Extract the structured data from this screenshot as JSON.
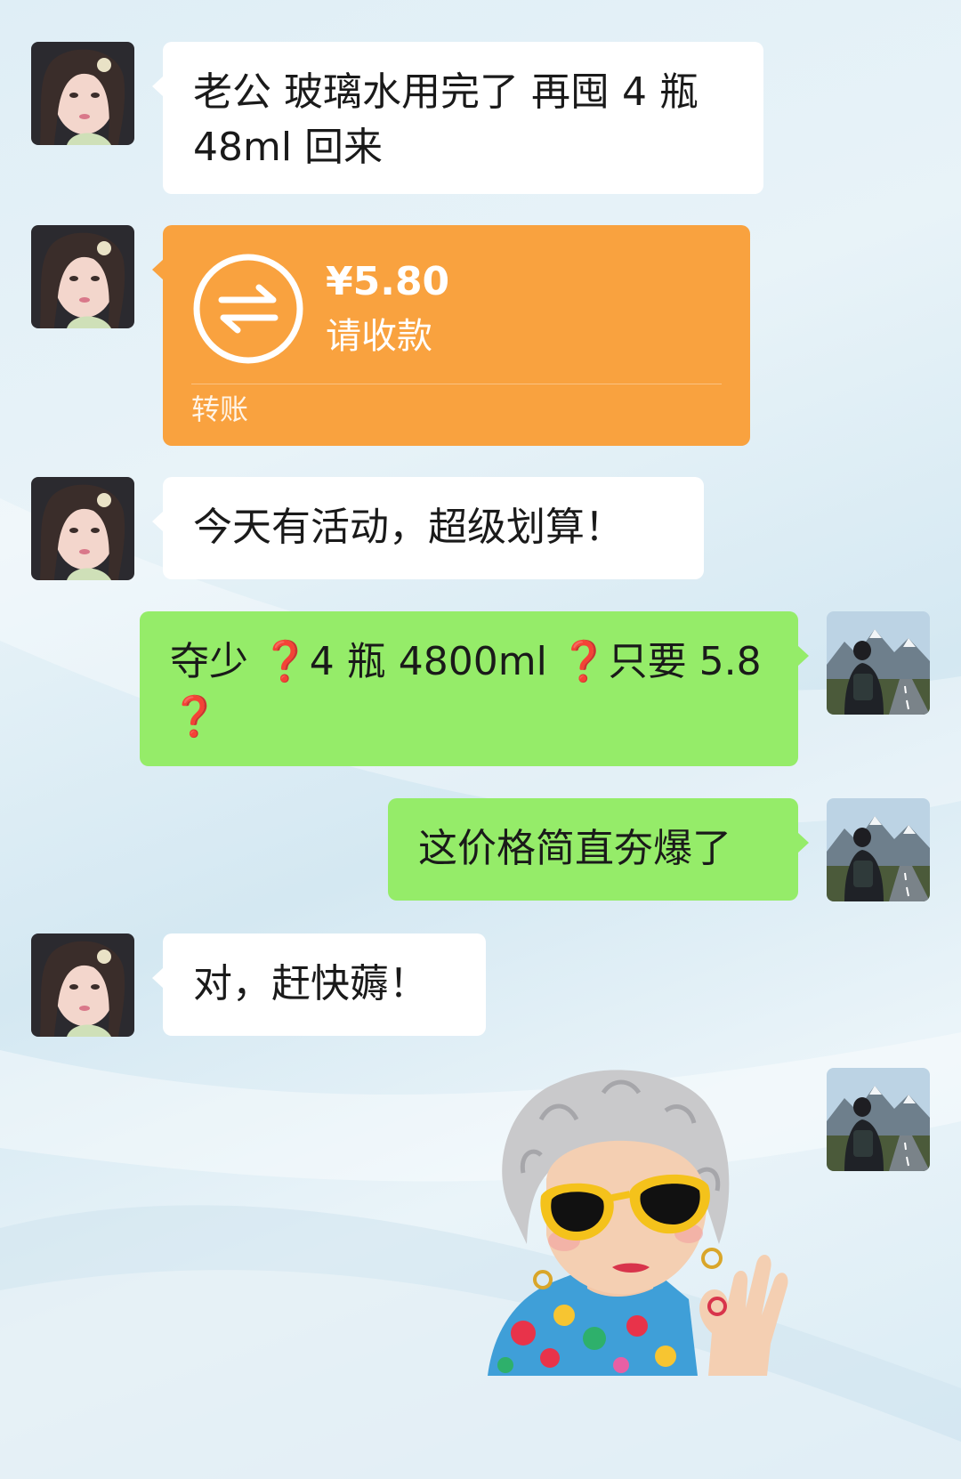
{
  "messages": [
    {
      "sender": "other",
      "text": "老公 玻璃水用完了 再囤 4 瓶\n48ml 回来"
    },
    {
      "sender": "other",
      "type": "transfer",
      "amount": "¥5.80",
      "status": "请收款",
      "label": "转账"
    },
    {
      "sender": "other",
      "text": "今天有活动，超级划算！"
    },
    {
      "sender": "me",
      "parts": [
        "夺少",
        "❓",
        "4 瓶 4800ml",
        "❓",
        "只要 5.8\n",
        "❓"
      ]
    },
    {
      "sender": "me",
      "text": "这价格简直夯爆了"
    },
    {
      "sender": "other",
      "text": "对，赶快薅！"
    },
    {
      "sender": "me",
      "type": "sticker",
      "sticker_icon": "grandma-sunglasses-ok-sticker"
    }
  ],
  "colors": {
    "my_bubble": "#95ec69",
    "other_bubble": "#ffffff",
    "transfer": "#f9a23f",
    "question_mark": "#d81e06"
  }
}
